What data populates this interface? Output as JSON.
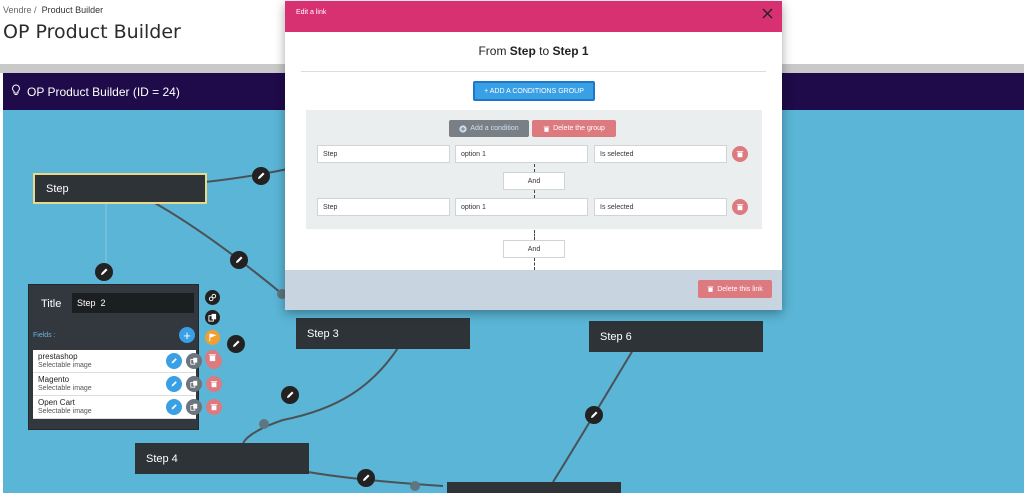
{
  "breadcrumb": {
    "parent": "Vendre",
    "separator": "/",
    "current": "Product Builder"
  },
  "page_title": "OP Product Builder",
  "builder": {
    "title": "OP Product Builder (ID = 24)"
  },
  "steps": [
    {
      "label": "Step"
    },
    {
      "label": "Step 3"
    },
    {
      "label": "Step 6"
    },
    {
      "label": "Step 4"
    },
    {
      "label": ""
    }
  ],
  "step_card": {
    "title_label": "Title",
    "title_value": "Step  2",
    "fields_label": "Fields :",
    "add_icon": "+",
    "fields": [
      {
        "name": "prestashop",
        "type": "Selectable image"
      },
      {
        "name": "Magento",
        "type": "Selectable image"
      },
      {
        "name": "Open Cart",
        "type": "Selectable image"
      }
    ]
  },
  "modal": {
    "header": "Edit a link",
    "title_from": "From",
    "title_from_step": "Step",
    "title_to": "to",
    "title_to_step": "Step 1",
    "add_group_label": "+ ADD A CONDITIONS GROUP",
    "add_condition_label": "Add a condition",
    "delete_group_label": "Delete the group",
    "conditions": [
      {
        "step": "Step",
        "option": "option 1",
        "state": "Is selected"
      },
      {
        "step": "Step",
        "option": "option 1",
        "state": "Is selected"
      }
    ],
    "and_label_1": "And",
    "and_label_2": "And",
    "delete_link_label": "Delete this link"
  },
  "colors": {
    "modal_header": "#d83171",
    "builder_header": "#1f0a4a",
    "canvas": "#5ab5d6",
    "primary": "#3aa0e6",
    "danger": "#dc7a80"
  }
}
